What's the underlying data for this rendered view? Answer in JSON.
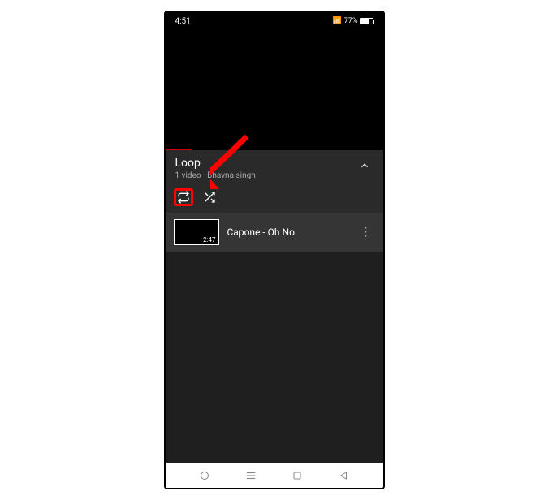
{
  "status": {
    "time": "4:51",
    "battery_pct": "77%"
  },
  "playlist": {
    "title": "Loop",
    "subtitle": "1 video · Bhavna singh"
  },
  "video_item": {
    "title": "Capone - Oh No",
    "duration": "2:47"
  }
}
